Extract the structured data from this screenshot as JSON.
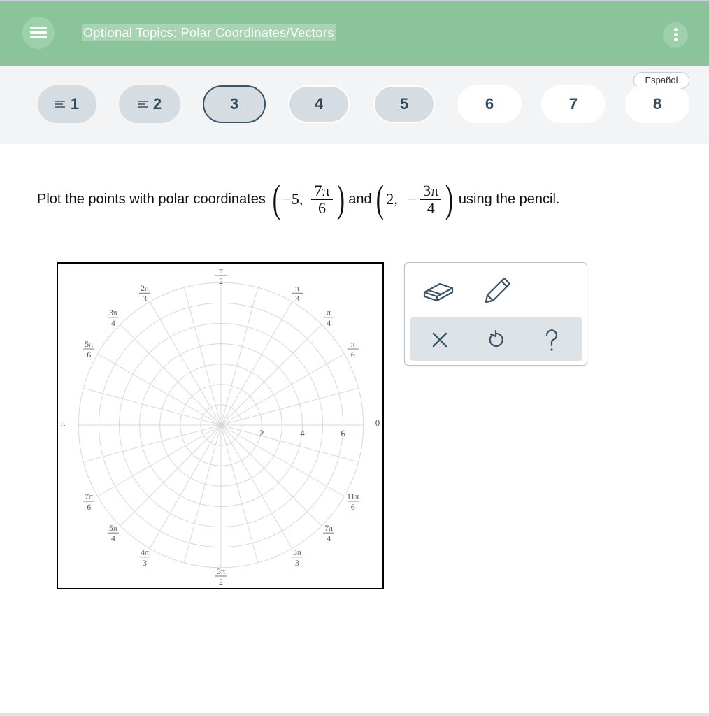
{
  "header": {
    "title": "Optional Topics: Polar Coordinates/Vectors",
    "menu_icon": "hamburger-menu-icon",
    "more_icon": "more-vertical-icon",
    "bg_color": "#8bc49b"
  },
  "question_nav": {
    "language_label": "Español",
    "items": [
      {
        "label": "1",
        "state": "answered"
      },
      {
        "label": "2",
        "state": "answered"
      },
      {
        "label": "3",
        "state": "current"
      },
      {
        "label": "4",
        "state": "attempted"
      },
      {
        "label": "5",
        "state": "attempted"
      },
      {
        "label": "6",
        "state": "unanswered"
      },
      {
        "label": "7",
        "state": "unanswered"
      },
      {
        "label": "8",
        "state": "unanswered"
      }
    ]
  },
  "problem": {
    "text_before": "Plot the points with polar coordinates",
    "point1": {
      "r": "−5,",
      "theta_num": "7π",
      "theta_den": "6"
    },
    "connector": "and",
    "point2": {
      "r": "2,",
      "theta_sign": "−",
      "theta_num": "3π",
      "theta_den": "4"
    },
    "text_after": "using the pencil."
  },
  "polar_grid": {
    "radius_labels": [
      "2",
      "4",
      "6"
    ],
    "zero_label": "0",
    "pi_label": "π",
    "angle_labels": [
      {
        "num": "π",
        "den": "6"
      },
      {
        "num": "π",
        "den": "4"
      },
      {
        "num": "π",
        "den": "3"
      },
      {
        "num": "π",
        "den": "2"
      },
      {
        "num": "2π",
        "den": "3"
      },
      {
        "num": "3π",
        "den": "4"
      },
      {
        "num": "5π",
        "den": "6"
      },
      {
        "num": "7π",
        "den": "6"
      },
      {
        "num": "5π",
        "den": "4"
      },
      {
        "num": "4π",
        "den": "3"
      },
      {
        "num": "3π",
        "den": "2"
      },
      {
        "num": "5π",
        "den": "3"
      },
      {
        "num": "7π",
        "den": "4"
      },
      {
        "num": "11π",
        "den": "6"
      }
    ],
    "grid_color": "#d9d9d9"
  },
  "tools": {
    "eraser_icon": "eraser-icon",
    "pencil_icon": "pencil-icon",
    "clear_icon": "close-icon",
    "undo_icon": "undo-icon",
    "help_icon": "help-question-icon",
    "accent": "#3b5364"
  }
}
